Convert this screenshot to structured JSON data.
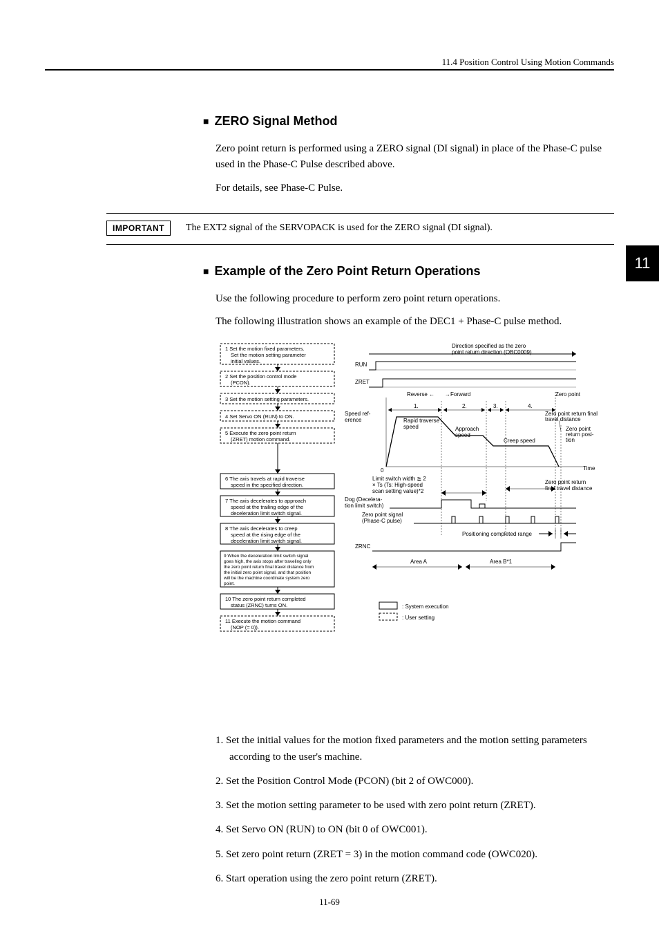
{
  "header": {
    "section": "11.4  Position Control Using Motion Commands"
  },
  "sideTab": "11",
  "zeroSignal": {
    "heading": "ZERO Signal Method",
    "p1": "Zero point return is performed using a ZERO signal (DI signal) in place of the Phase-C pulse used in the Phase-C Pulse described above.",
    "p2": "For details, see Phase-C Pulse."
  },
  "important": {
    "label": "IMPORTANT",
    "text": "The EXT2 signal of the SERVOPACK is used for the ZERO signal (DI signal)."
  },
  "example": {
    "heading": "Example of the Zero Point Return Operations",
    "p1": "Use the following procedure to perform zero point return operations.",
    "p2": "The following illustration shows an example of the DEC1 + Phase-C pulse method."
  },
  "flow": {
    "s1a": "1  Set the motion fixed parameters.",
    "s1b": "Set the motion setting parameter",
    "s1c": "initial values.",
    "s2a": "2  Set the position control mode",
    "s2b": "(PCON).",
    "s3": "3  Set the motion setting parameters.",
    "s4": "4  Set Servo ON (RUN) to ON.",
    "s5a": "5  Execute the zero point return",
    "s5b": "(ZRET) motion command.",
    "s6a": "6  The axis travels at rapid traverse",
    "s6b": "speed in the specified direction.",
    "s7a": "7  The axis decelerates to approach",
    "s7b": "speed at the trailing edge of the",
    "s7c": "deceleration limit switch signal.",
    "s8a": "8  The axis decelerates to creep",
    "s8b": "speed at the rising edge of the",
    "s8c": "deceleration limit switch signal.",
    "s9a": "9 When the deceleration limit switch signal",
    "s9b": "goes high, the axis stops after traveling only",
    "s9c": "the zero point return final travel distance from",
    "s9d": "the initial zero point signal, and that position",
    "s9e": "will be the machine coordinate system zero",
    "s9f": "point.",
    "s10a": "10 The zero point return completed",
    "s10b": "status (ZRNC) turns ON.",
    "s11a": "11 Execute the motion command",
    "s11b": "(NOP (= 0)).",
    "legendSys": ": System execution",
    "legendUser": ": User setting"
  },
  "chart": {
    "dirLabel": "Direction specified as the zero",
    "dirLabel2": "point return direction (OBC0009)",
    "run": "RUN",
    "zret": "ZRET",
    "zrnc": "ZRNC",
    "reverse": "Reverse ←",
    "forward": "→Forward",
    "zeroPoint": "Zero point",
    "n1": "1.",
    "n2": "2.",
    "n3": "3.",
    "n4": "4.",
    "speedRef": "Speed ref-",
    "speedRef2": "erence",
    "rapid": "Rapid traverse",
    "rapid2": "speed",
    "approach": "Approach",
    "approach2": "speed",
    "creep": "Creep speed",
    "zprFinal": "Zero point return final",
    "zprFinal2": "travel distance",
    "zprPos": "Zero point",
    "zprPos2": "return posi-",
    "zprPos3": "tion",
    "zero": "0",
    "time": "Time",
    "limitW": "Limit switch width ≧ 2",
    "limitW2": "× Ts (Ts: High-speed",
    "limitW3": "scan setting value)*2",
    "dog": "Dog (Decelera-",
    "dog2": "tion limit switch)",
    "zpSig": "Zero point signal",
    "zpSig2": "(Phase-C pulse)",
    "posComp": "Positioning completed range",
    "areaA": "Area A",
    "areaB": "Area B*1",
    "zprFinalB": "Zero point return",
    "zprFinalB2": "final travel distance"
  },
  "list": {
    "i1": "1.  Set the initial values for the motion fixed parameters and the motion setting parameters according to the user's machine.",
    "i2": "2.  Set the Position Control Mode (PCON) (bit 2 of OWC000).",
    "i3": "3.  Set the motion setting parameter to be used with zero point return (ZRET).",
    "i4": "4.  Set Servo ON (RUN) to ON (bit 0 of OWC001).",
    "i5": "5.  Set zero point return (ZRET = 3) in the motion command code (OWC020).",
    "i6": "6.  Start operation using the zero point return (ZRET)."
  },
  "pageNo": "11-69"
}
